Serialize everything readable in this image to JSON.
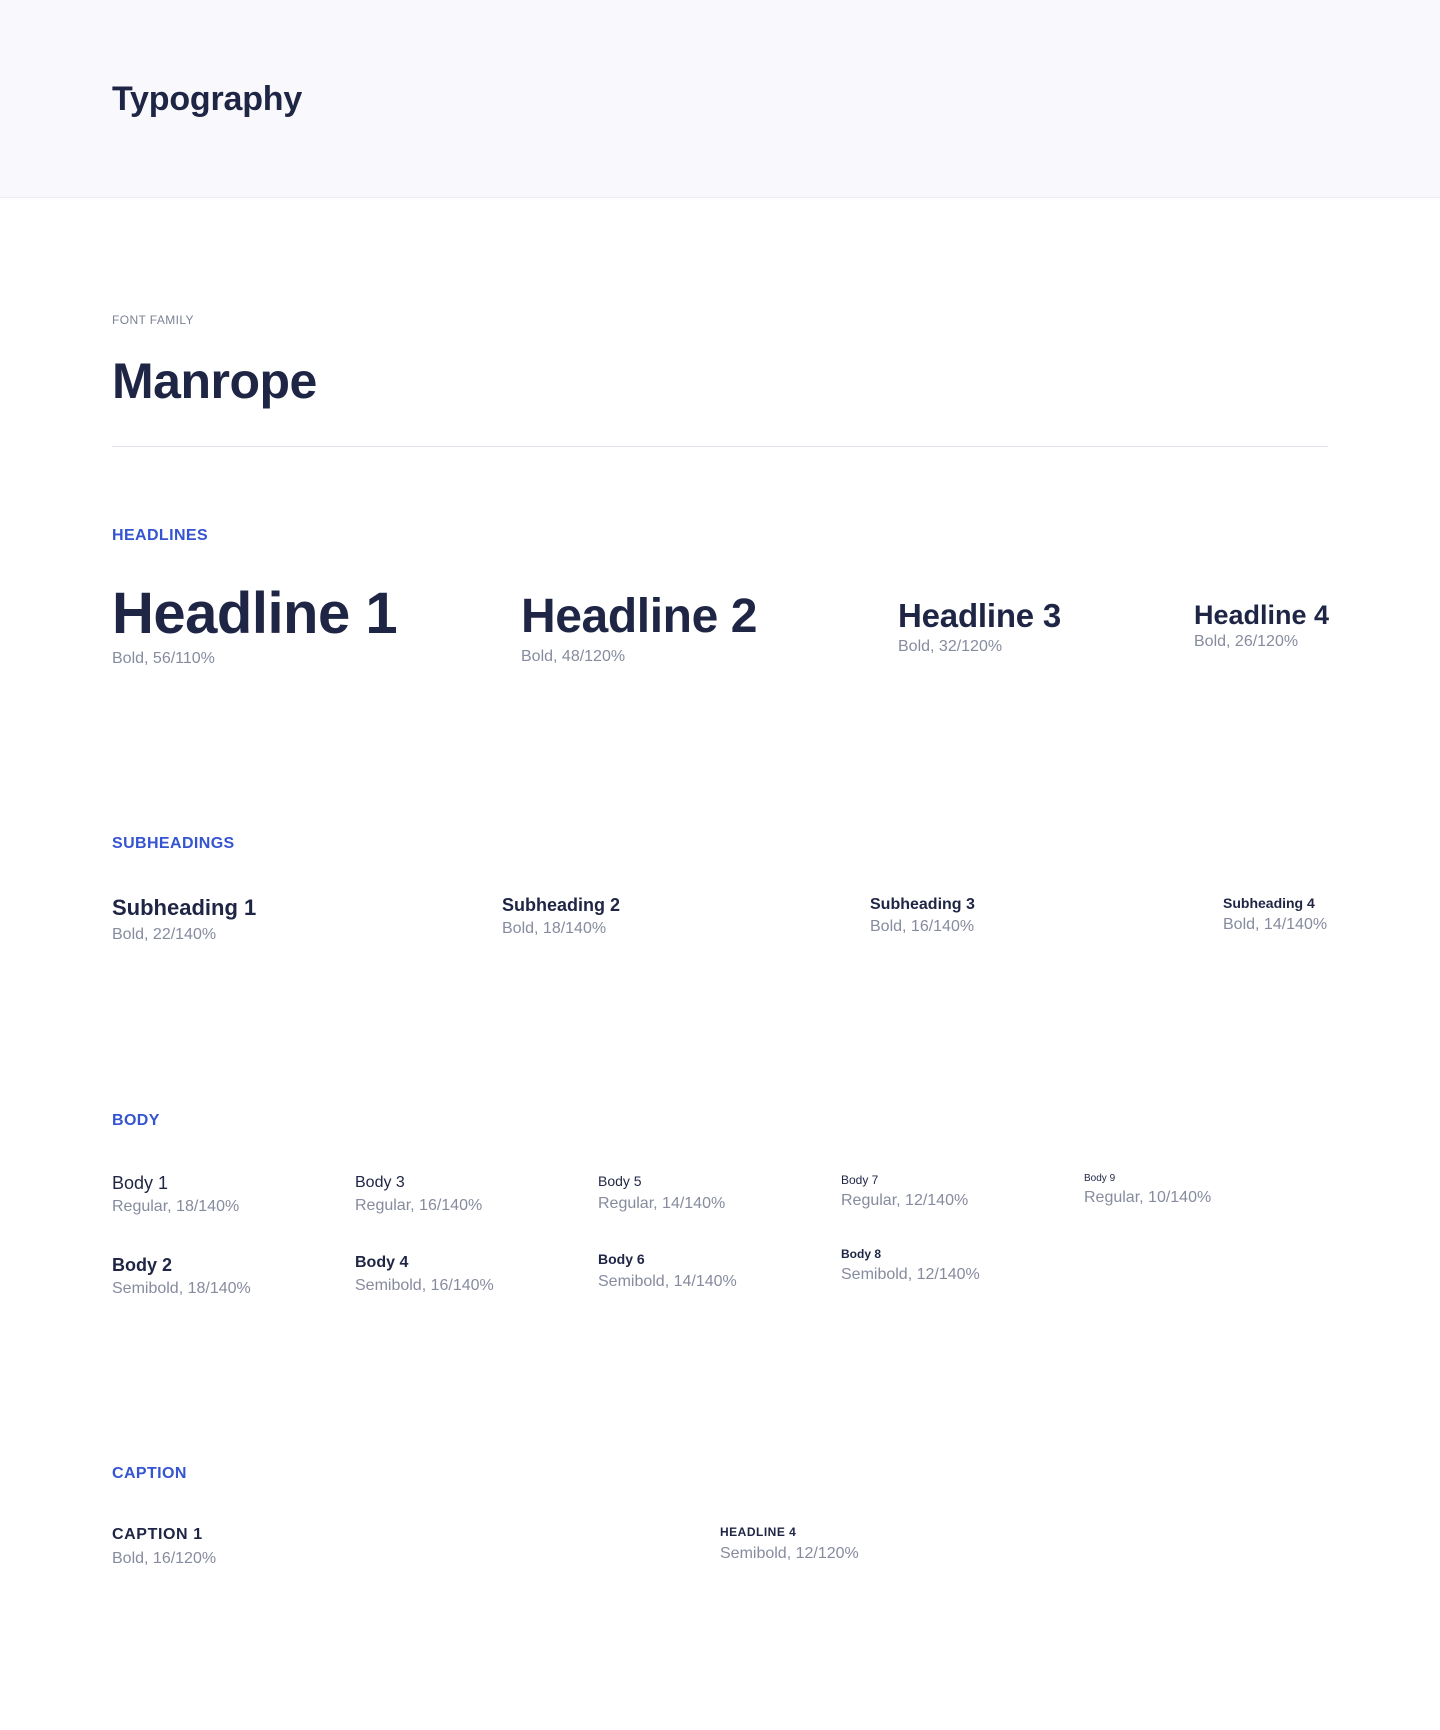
{
  "header": {
    "title": "Typography"
  },
  "font_family": {
    "label": "FONT FAMILY",
    "name": "Manrope"
  },
  "headlines": {
    "label": "HEADLINES",
    "items": [
      {
        "name": "Headline 1",
        "spec": "Bold, 56/110%"
      },
      {
        "name": "Headline 2",
        "spec": "Bold, 48/120%"
      },
      {
        "name": "Headline 3",
        "spec": "Bold, 32/120%"
      },
      {
        "name": "Headline 4",
        "spec": "Bold, 26/120%"
      }
    ]
  },
  "subheadings": {
    "label": "SUBHEADINGS",
    "items": [
      {
        "name": "Subheading 1",
        "spec": "Bold, 22/140%"
      },
      {
        "name": "Subheading 2",
        "spec": "Bold, 18/140%"
      },
      {
        "name": "Subheading 3",
        "spec": "Bold, 16/140%"
      },
      {
        "name": "Subheading 4",
        "spec": "Bold, 14/140%"
      }
    ]
  },
  "body": {
    "label": "BODY",
    "items": [
      {
        "name": "Body 1",
        "spec": "Regular, 18/140%"
      },
      {
        "name": "Body 2",
        "spec": "Semibold, 18/140%"
      },
      {
        "name": "Body 3",
        "spec": "Regular, 16/140%"
      },
      {
        "name": "Body 4",
        "spec": "Semibold, 16/140%"
      },
      {
        "name": "Body 5",
        "spec": "Regular, 14/140%"
      },
      {
        "name": "Body 6",
        "spec": "Semibold, 14/140%"
      },
      {
        "name": "Body 7",
        "spec": "Regular, 12/140%"
      },
      {
        "name": "Body 8",
        "spec": "Semibold, 12/140%"
      },
      {
        "name": "Body 9",
        "spec": "Regular, 10/140%"
      }
    ]
  },
  "caption": {
    "label": "CAPTION",
    "items": [
      {
        "name": "CAPTION 1",
        "spec": "Bold, 16/120%"
      },
      {
        "name": "HEADLINE 4",
        "spec": "Semibold, 12/120%"
      }
    ]
  },
  "colors": {
    "text_primary": "#1f2544",
    "text_secondary": "#868b9e",
    "accent": "#3554d1",
    "header_bg": "#f9f9fd"
  }
}
